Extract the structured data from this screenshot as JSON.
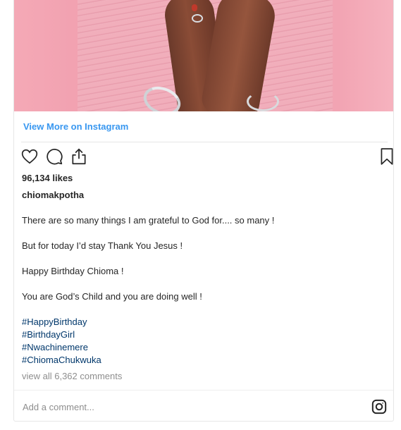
{
  "post": {
    "view_more_label": "View More on Instagram",
    "likes": "96,134 likes",
    "username": "chiomakpotha",
    "caption_lines": [
      "There are so many things I am grateful to God for.... so many !",
      "But for today I’d stay Thank You Jesus !",
      "Happy Birthday Chioma !",
      "You are God’s Child and you are doing well !"
    ],
    "hashtags": [
      "#HappyBirthday",
      "#BirthdayGirl",
      "#Nwachinemere",
      "#ChiomaChukwuka"
    ],
    "view_comments_label": "view all 6,362 comments",
    "comment_placeholder": "Add a comment..."
  },
  "icons": {
    "like": "heart-icon",
    "comment": "comment-icon",
    "share": "share-icon",
    "save": "bookmark-icon",
    "instagram": "instagram-icon"
  },
  "colors": {
    "link_blue": "#3897f0",
    "hashtag_blue": "#00376b",
    "muted_gray": "#8e8e8e",
    "text": "#262626"
  }
}
